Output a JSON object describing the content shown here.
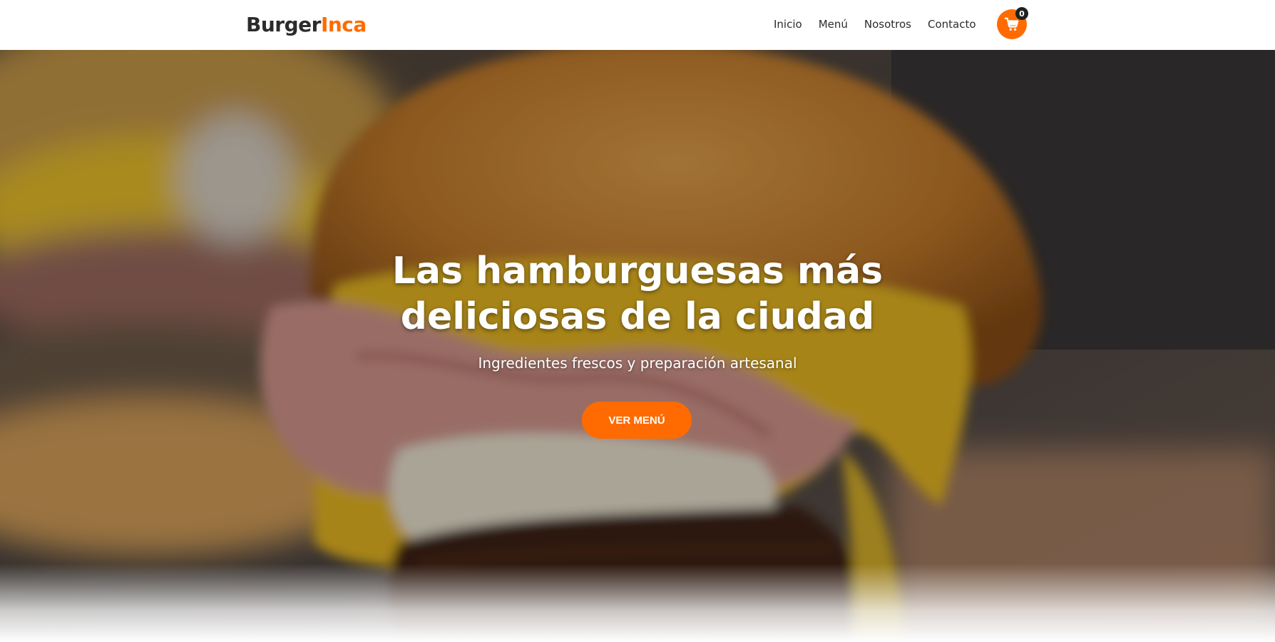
{
  "brand": {
    "part1": "Burger",
    "part2": "Inca"
  },
  "nav": [
    {
      "label": "Inicio"
    },
    {
      "label": "Menú"
    },
    {
      "label": "Nosotros"
    },
    {
      "label": "Contacto"
    }
  ],
  "cart": {
    "count": "0",
    "icon": "shopping-cart-icon"
  },
  "hero": {
    "title_line1": "Las hamburguesas más",
    "title_line2": "deliciosas de la ciudad",
    "subtitle": "Ingredientes frescos y preparación artesanal",
    "cta_label": "VER MENÚ",
    "image": "burger-photo"
  },
  "colors": {
    "accent": "#ff6b00",
    "text_dark": "#2c2c2c",
    "white": "#ffffff"
  }
}
